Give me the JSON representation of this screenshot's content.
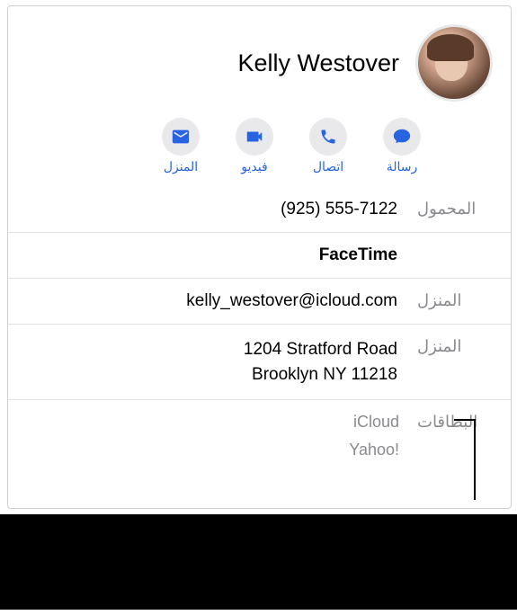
{
  "contact": {
    "name": "Kelly Westover"
  },
  "actions": {
    "message": "رسالة",
    "call": "اتصال",
    "video": "فيديو",
    "mail": "المنزل"
  },
  "rows": {
    "mobile": {
      "label": "المحمول",
      "value": "(925) 555-7122"
    },
    "facetime": {
      "label": "",
      "value": "FaceTime"
    },
    "email": {
      "label": "المنزل",
      "value": "kelly_westover@icloud.com"
    },
    "address": {
      "label": "المنزل",
      "value": "1204 Stratford Road\nBrooklyn NY 11218"
    },
    "cards": {
      "label": "البطاقات",
      "items": [
        "iCloud",
        "Yahoo!"
      ]
    }
  }
}
